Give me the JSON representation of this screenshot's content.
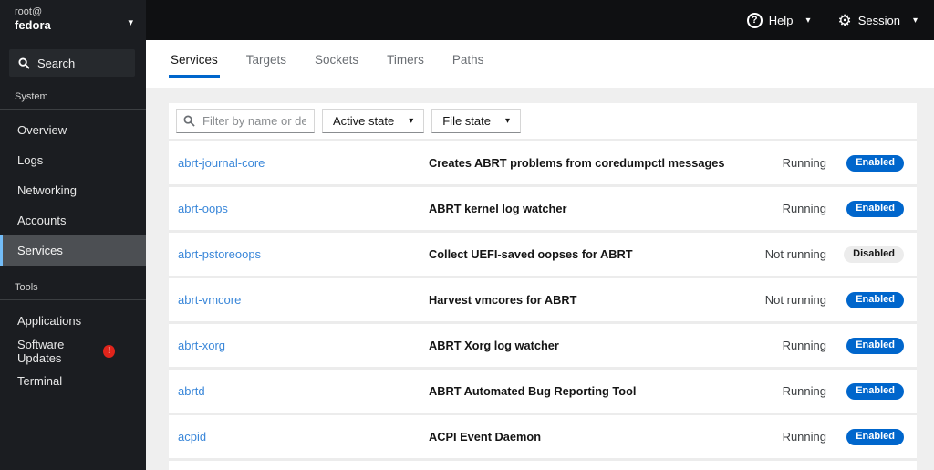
{
  "icons": {
    "caret": "▾",
    "gear": "⚙",
    "help_glyph": "?",
    "alert_glyph": "!"
  },
  "colors": {
    "accent": "#0066cc",
    "link": "#3a87d9",
    "danger": "#e0241b",
    "sidebar_bg": "#1b1d21",
    "masthead_bg": "#0f1012",
    "selected_border": "#73bcf7"
  },
  "masthead": {
    "help_label": "Help",
    "session_label": "Session"
  },
  "sidebar": {
    "host_user": "root@",
    "host_name": "fedora",
    "search_label": "Search",
    "sections": [
      {
        "label": "System",
        "items": [
          {
            "label": "Overview",
            "selected": false
          },
          {
            "label": "Logs",
            "selected": false
          },
          {
            "label": "Networking",
            "selected": false
          },
          {
            "label": "Accounts",
            "selected": false
          },
          {
            "label": "Services",
            "selected": true
          }
        ]
      },
      {
        "label": "Tools",
        "items": [
          {
            "label": "Applications",
            "selected": false
          },
          {
            "label": "Software Updates",
            "selected": false,
            "badge": "!"
          },
          {
            "label": "Terminal",
            "selected": false
          }
        ]
      }
    ]
  },
  "tabs": [
    {
      "label": "Services",
      "active": true
    },
    {
      "label": "Targets",
      "active": false
    },
    {
      "label": "Sockets",
      "active": false
    },
    {
      "label": "Timers",
      "active": false
    },
    {
      "label": "Paths",
      "active": false
    }
  ],
  "toolbar": {
    "filter_placeholder": "Filter by name or descrip...",
    "active_state_label": "Active state",
    "file_state_label": "File state"
  },
  "services": [
    {
      "name": "abrt-journal-core",
      "description": "Creates ABRT problems from coredumpctl messages",
      "state": "Running",
      "file_state": "Enabled",
      "enabled": true
    },
    {
      "name": "abrt-oops",
      "description": "ABRT kernel log watcher",
      "state": "Running",
      "file_state": "Enabled",
      "enabled": true
    },
    {
      "name": "abrt-pstoreoops",
      "description": "Collect UEFI-saved oopses for ABRT",
      "state": "Not running",
      "file_state": "Disabled",
      "enabled": false
    },
    {
      "name": "abrt-vmcore",
      "description": "Harvest vmcores for ABRT",
      "state": "Not running",
      "file_state": "Enabled",
      "enabled": true
    },
    {
      "name": "abrt-xorg",
      "description": "ABRT Xorg log watcher",
      "state": "Running",
      "file_state": "Enabled",
      "enabled": true
    },
    {
      "name": "abrtd",
      "description": "ABRT Automated Bug Reporting Tool",
      "state": "Running",
      "file_state": "Enabled",
      "enabled": true
    },
    {
      "name": "acpid",
      "description": "ACPI Event Daemon",
      "state": "Running",
      "file_state": "Enabled",
      "enabled": true
    }
  ]
}
